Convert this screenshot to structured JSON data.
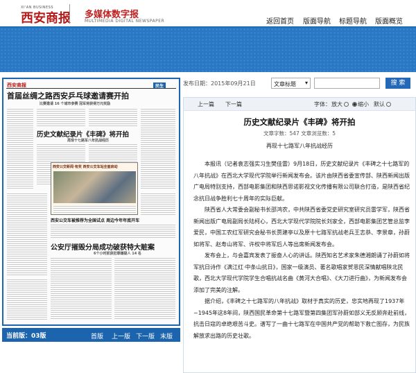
{
  "header": {
    "logo_en": "XI'AN BUSINESS",
    "logo": "西安商报",
    "slogan": "多媒体数字报",
    "slogan_en": "MULTIMEDIA DIGITAL NEWSPAPER",
    "nav": [
      "返回首页",
      "版面导航",
      "标题导航",
      "版面概览"
    ]
  },
  "paper": {
    "masthead": "西安商报",
    "page_badge": "民生",
    "headline1": "首届丝绸之路西安乒乓球邀请赛开拍",
    "sub1": "比赛邀请 16 个城市参赛  冠军将获得万元奖励",
    "headline2": "历史文献纪录片《丰碑》将开拍",
    "sub2": "再现十七路军八年抗战经历",
    "banner": "西安公交新闻·有奖  西安公交车站全面启动",
    "headline3": "西安公交车被推荐为全国试点 周边今年年底开车",
    "headline4": "公安厅摧毁分局成功破获特大赃案",
    "sub4": "6个小时抓获犯罪嫌疑人 14 名"
  },
  "bottom": {
    "page_label": "当前版：03版",
    "links": [
      "首版",
      "上一版",
      "下一版",
      "末版"
    ]
  },
  "search": {
    "date": "发布日期：2015年09月21日",
    "select_value": "文章标题",
    "button": "搜  索"
  },
  "article": {
    "prev": "上一篇",
    "next": "下一篇",
    "font_label": "字体：",
    "font_options": [
      "放大",
      "缩小",
      "默认"
    ],
    "font_selected": "缩小",
    "title": "历史文献纪录片《丰碑》将开拍",
    "meta": "文章字数：547    文章浏览数：5",
    "subtitle": "再现十七路军八年抗战经历",
    "paragraphs": [
      "本报讯（记者袁志强实习生樊佳雷）9月18日，历史文献纪录片《丰碑之十七路军的八年抗战》在西北大学现代学院举行新闻发布会。该片由陕西省委宣传部、陕西新闻出版广电局特别支持，西部电影集团和陕西思诺影视文化传播有限公司联合打造，是陕西省纪念抗日战争胜利七十周年的实际巨献。",
      "陕西省人大常委会副秘书长邵鸿农，中共陕西省委党史研究室研究员雷学军，陕西省新闻出版广电局副局长陆柯心，西北大学现代学院院长刘家全，西部电影集团艺管总监李爱民，中国工农红军研究会秘书长贾建亭以及原十七路军抗战老兵王志恭、李景章，孙蔚如将军、赵寿山将军、许权中将军后人等出席新闻发布会。",
      "发布会上，与会嘉宾发表了振奋人心的讲话。陕西知名艺术家朱德湘朗诵了孙蔚如将军抗日诗作《满江红·中条山抗日》，国家一级演员、著名歌唱家贺恩民深情献唱陕北民歌，西北大学现代学院学生合唱抗战名曲《黄河大合唱》、《大刀进行曲》，为新闻发布会添加了完美的注解。",
      "据介绍，《丰碑之十七路军的八年抗战》取材于真实的历史，忠实地再现了1937年~1945年这8年间，陕西国民革命第十七路军暨第四集团军孙蔚如部义无反顾奔赴前线，抗击日寇的卓绝艰苦斗史。谱写了一曲十七路军在中国共产党的帮助下救亡图存，为民族解放求出路的历史壮歌。"
    ]
  }
}
